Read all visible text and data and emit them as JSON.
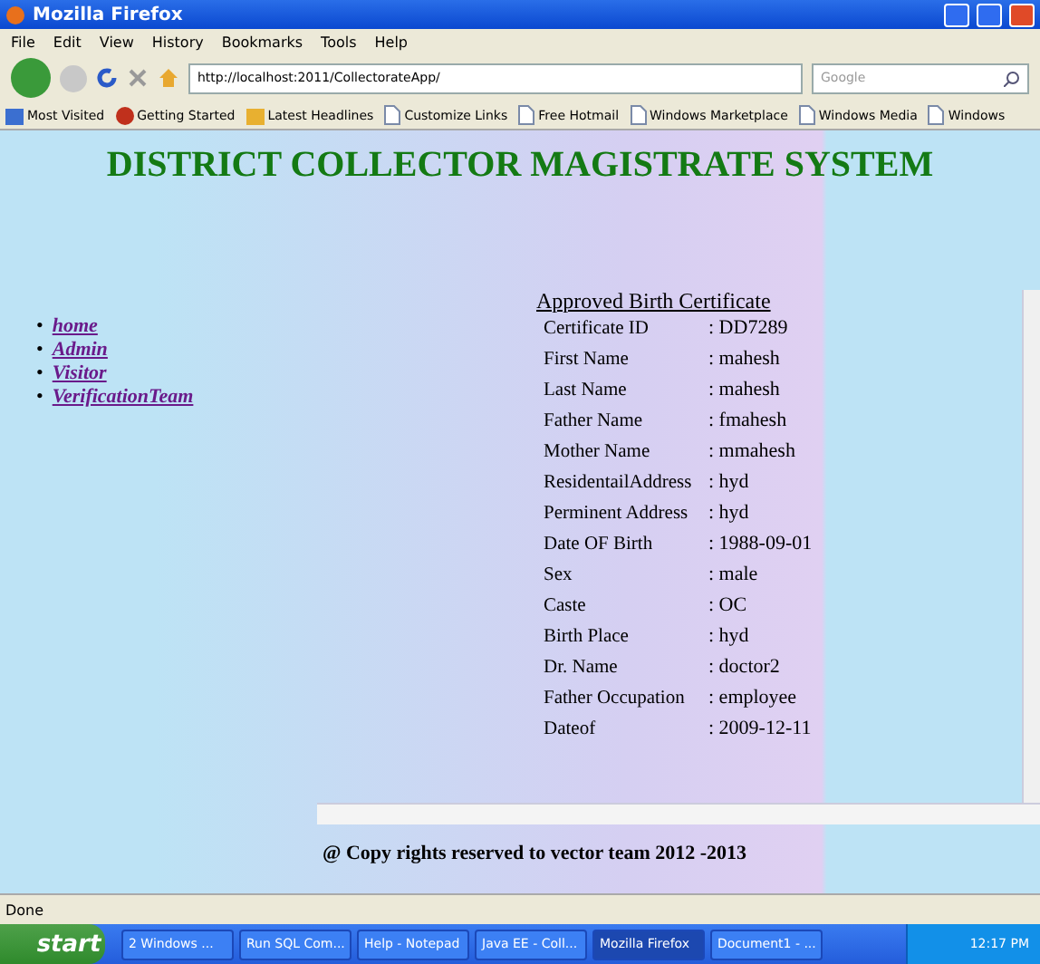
{
  "window": {
    "title": "Mozilla Firefox"
  },
  "menu": [
    "File",
    "Edit",
    "View",
    "History",
    "Bookmarks",
    "Tools",
    "Help"
  ],
  "address": {
    "value": "http://localhost:2011/CollectorateApp/"
  },
  "search": {
    "placeholder": "Google"
  },
  "bookmarks": [
    {
      "label": "Most Visited",
      "kind": "folder"
    },
    {
      "label": "Getting Started",
      "kind": "firefox"
    },
    {
      "label": "Latest Headlines",
      "kind": "feed"
    },
    {
      "label": "Customize Links",
      "kind": "page"
    },
    {
      "label": "Free Hotmail",
      "kind": "page"
    },
    {
      "label": "Windows Marketplace",
      "kind": "page"
    },
    {
      "label": "Windows Media",
      "kind": "page"
    },
    {
      "label": "Windows",
      "kind": "page"
    }
  ],
  "page": {
    "title": "DISTRICT COLLECTOR MAGISTRATE SYSTEM",
    "nav": [
      {
        "bullet": "•",
        "label": "home"
      },
      {
        "bullet": "•",
        "label": "Admin"
      },
      {
        "bullet": "•",
        "label": "Visitor"
      },
      {
        "bullet": "•",
        "label": "VerificationTeam"
      }
    ],
    "certificate": {
      "heading": "Approved Birth Certificate",
      "rows": [
        {
          "label": "Certificate ID",
          "value": ": DD7289"
        },
        {
          "label": "First Name",
          "value": ": mahesh"
        },
        {
          "label": "Last Name",
          "value": ": mahesh"
        },
        {
          "label": "Father Name",
          "value": ": fmahesh"
        },
        {
          "label": "Mother Name",
          "value": ": mmahesh"
        },
        {
          "label": "ResidentailAddress",
          "value": ": hyd"
        },
        {
          "label": "Perminent Address",
          "value": ": hyd"
        },
        {
          "label": "Date OF Birth",
          "value": ": 1988-09-01"
        },
        {
          "label": "Sex",
          "value": ": male"
        },
        {
          "label": "Caste",
          "value": ": OC"
        },
        {
          "label": "Birth Place",
          "value": ": hyd"
        },
        {
          "label": "Dr. Name",
          "value": ": doctor2"
        },
        {
          "label": "Father Occupation",
          "value": ": employee"
        },
        {
          "label": "Dateof",
          "value": ": 2009-12-11"
        }
      ]
    },
    "footer": "@ Copy rights reserved to vector team 2012 -2013"
  },
  "status_bar": "Done",
  "taskbar": {
    "start": "start",
    "items": [
      {
        "label": "2 Windows ...",
        "selected": false
      },
      {
        "label": "Run SQL Com...",
        "selected": false
      },
      {
        "label": "Help - Notepad",
        "selected": false
      },
      {
        "label": "Java EE - Coll...",
        "selected": false
      },
      {
        "label": "Mozilla Firefox",
        "selected": true
      },
      {
        "label": "Document1 - ...",
        "selected": false
      }
    ],
    "clock": "12:17 PM"
  }
}
